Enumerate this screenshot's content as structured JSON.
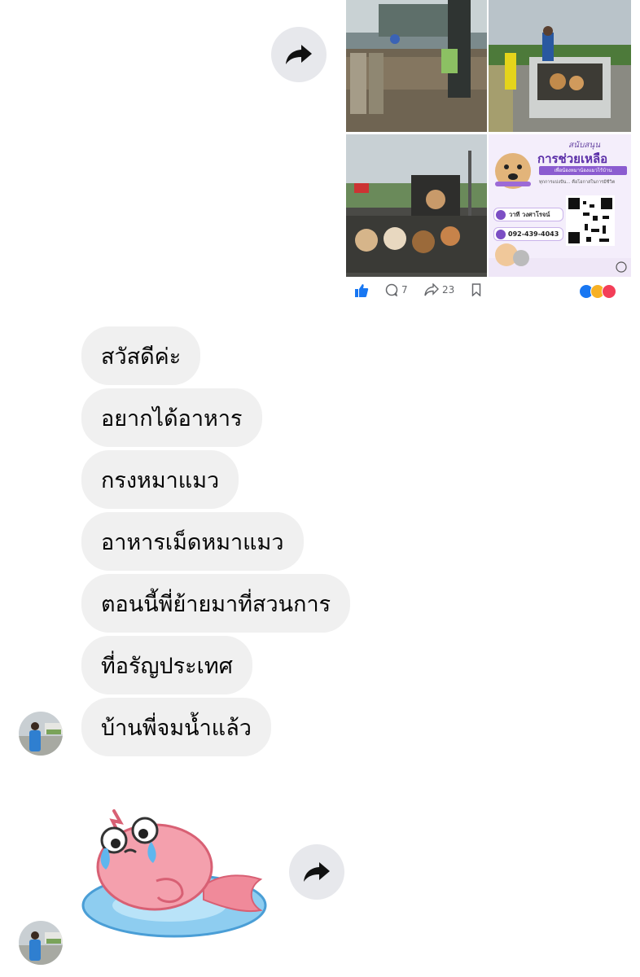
{
  "post": {
    "promo": {
      "header_small": "สนับสนุน",
      "headline": "การช่วยเหลือ",
      "subline": "เพื่อน้องหมาน้องแมวไร้บ้าน",
      "tagline": "ทุกการแบ่งปัน... คือโอกาสในการมีชีวิต",
      "account_name": "วาที วงศาโรจน์",
      "phone": "092-439-4043"
    },
    "actions": {
      "comment_count": "7",
      "share_count": "23"
    }
  },
  "messages": [
    {
      "text": "สวัสดีค่ะ"
    },
    {
      "text": "อยากได้อาหาร"
    },
    {
      "text": "กรงหมาแมว"
    },
    {
      "text": "อาหารเม็ดหมาแมว"
    },
    {
      "text": "ตอนนี้พี่ย้ายมาที่สวนการ"
    },
    {
      "text": "ที่อรัญประเทศ"
    },
    {
      "text": "บ้านพี่จมน้ำแล้ว"
    }
  ],
  "colors": {
    "bubble_bg": "#f0f0f0",
    "forward_bg": "#e7e8ec",
    "like_blue": "#1877f2",
    "promo_purple": "#7c4fc4"
  },
  "icons": [
    "share-arrow-icon",
    "like-icon",
    "comment-icon",
    "share-icon",
    "bookmark-icon",
    "reactions-icon",
    "sticker-crying-shrimp"
  ]
}
